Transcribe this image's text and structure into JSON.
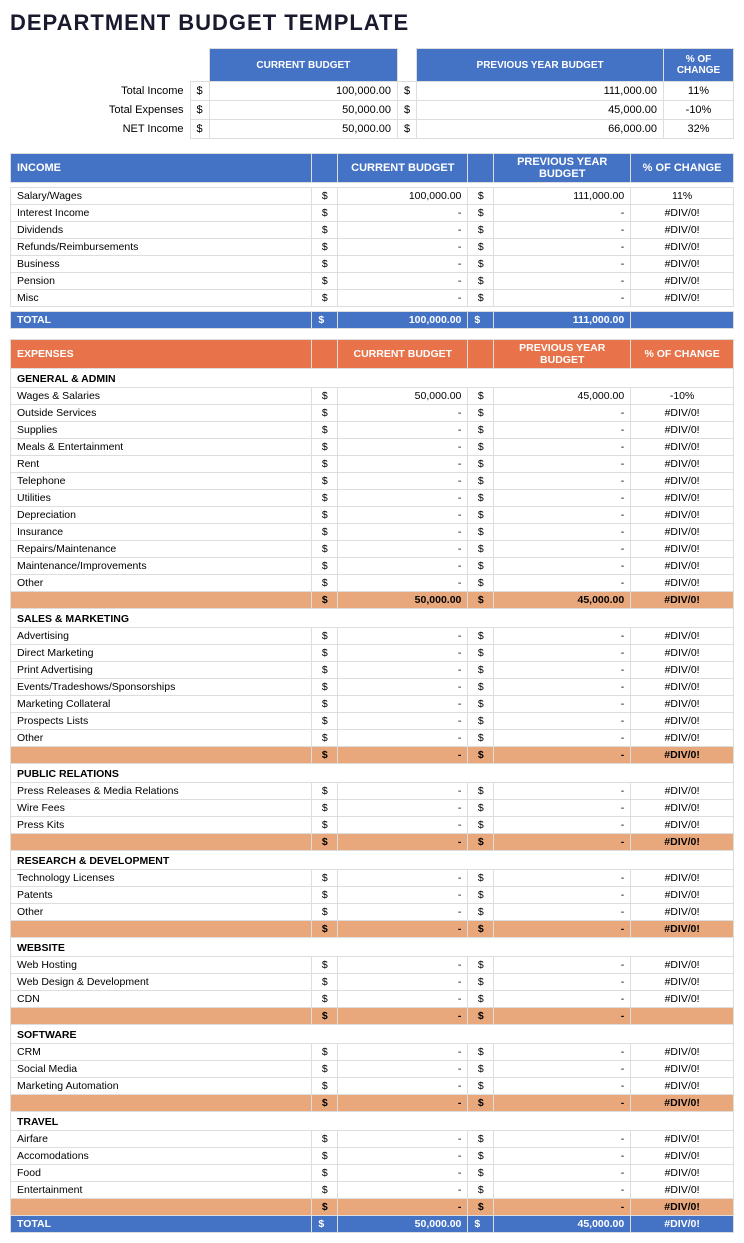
{
  "title": "DEPARTMENT BUDGET TEMPLATE",
  "summary": {
    "headers": [
      "CURRENT BUDGET",
      "PREVIOUS YEAR BUDGET",
      "% OF CHANGE"
    ],
    "rows": [
      {
        "label": "Total Income",
        "curr_dollar": "$",
        "curr_val": "100,000.00",
        "prev_dollar": "$",
        "prev_val": "111,000.00",
        "pct": "11%"
      },
      {
        "label": "Total Expenses",
        "curr_dollar": "$",
        "curr_val": "50,000.00",
        "prev_dollar": "$",
        "prev_val": "45,000.00",
        "pct": "-10%"
      },
      {
        "label": "NET Income",
        "curr_dollar": "$",
        "curr_val": "50,000.00",
        "prev_dollar": "$",
        "prev_val": "66,000.00",
        "pct": "32%"
      }
    ]
  },
  "income": {
    "section_label": "INCOME",
    "col_headers": [
      "CURRENT BUDGET",
      "PREVIOUS YEAR BUDGET",
      "% OF CHANGE"
    ],
    "rows": [
      {
        "label": "Salary/Wages",
        "curr_val": "100,000.00",
        "prev_val": "111,000.00",
        "pct": "11%"
      },
      {
        "label": "Interest Income",
        "curr_val": "-",
        "prev_val": "-",
        "pct": "#DIV/0!"
      },
      {
        "label": "Dividends",
        "curr_val": "-",
        "prev_val": "-",
        "pct": "#DIV/0!"
      },
      {
        "label": "Refunds/Reimbursements",
        "curr_val": "-",
        "prev_val": "-",
        "pct": "#DIV/0!"
      },
      {
        "label": "Business",
        "curr_val": "-",
        "prev_val": "-",
        "pct": "#DIV/0!"
      },
      {
        "label": "Pension",
        "curr_val": "-",
        "prev_val": "-",
        "pct": "#DIV/0!"
      },
      {
        "label": "Misc",
        "curr_val": "-",
        "prev_val": "-",
        "pct": "#DIV/0!"
      }
    ],
    "total_label": "TOTAL",
    "total_curr": "100,000.00",
    "total_prev": "111,000.00"
  },
  "expenses": {
    "section_label": "EXPENSES",
    "col_headers": [
      "CURRENT BUDGET",
      "PREVIOUS YEAR BUDGET",
      "% OF CHANGE"
    ],
    "subsections": [
      {
        "name": "GENERAL & ADMIN",
        "rows": [
          {
            "label": "Wages & Salaries",
            "curr_val": "50,000.00",
            "prev_val": "45,000.00",
            "pct": "-10%"
          },
          {
            "label": "Outside Services",
            "curr_val": "-",
            "prev_val": "-",
            "pct": "#DIV/0!"
          },
          {
            "label": "Supplies",
            "curr_val": "-",
            "prev_val": "-",
            "pct": "#DIV/0!"
          },
          {
            "label": "Meals & Entertainment",
            "curr_val": "-",
            "prev_val": "-",
            "pct": "#DIV/0!"
          },
          {
            "label": "Rent",
            "curr_val": "-",
            "prev_val": "-",
            "pct": "#DIV/0!"
          },
          {
            "label": "Telephone",
            "curr_val": "-",
            "prev_val": "-",
            "pct": "#DIV/0!"
          },
          {
            "label": "Utilities",
            "curr_val": "-",
            "prev_val": "-",
            "pct": "#DIV/0!"
          },
          {
            "label": "Depreciation",
            "curr_val": "-",
            "prev_val": "-",
            "pct": "#DIV/0!"
          },
          {
            "label": "Insurance",
            "curr_val": "-",
            "prev_val": "-",
            "pct": "#DIV/0!"
          },
          {
            "label": "Repairs/Maintenance",
            "curr_val": "-",
            "prev_val": "-",
            "pct": "#DIV/0!"
          },
          {
            "label": "Maintenance/Improvements",
            "curr_val": "-",
            "prev_val": "-",
            "pct": "#DIV/0!"
          },
          {
            "label": "Other",
            "curr_val": "-",
            "prev_val": "-",
            "pct": "#DIV/0!"
          }
        ],
        "subtotal_curr": "50,000.00",
        "subtotal_prev": "45,000.00",
        "subtotal_pct": "#DIV/0!"
      },
      {
        "name": "SALES & MARKETING",
        "rows": [
          {
            "label": "Advertising",
            "curr_val": "-",
            "prev_val": "-",
            "pct": "#DIV/0!"
          },
          {
            "label": "Direct Marketing",
            "curr_val": "-",
            "prev_val": "-",
            "pct": "#DIV/0!"
          },
          {
            "label": "Print Advertising",
            "curr_val": "-",
            "prev_val": "-",
            "pct": "#DIV/0!"
          },
          {
            "label": "Events/Tradeshows/Sponsorships",
            "curr_val": "-",
            "prev_val": "-",
            "pct": "#DIV/0!"
          },
          {
            "label": "Marketing Collateral",
            "curr_val": "-",
            "prev_val": "-",
            "pct": "#DIV/0!"
          },
          {
            "label": "Prospects Lists",
            "curr_val": "-",
            "prev_val": "-",
            "pct": "#DIV/0!"
          },
          {
            "label": "Other",
            "curr_val": "-",
            "prev_val": "-",
            "pct": "#DIV/0!"
          }
        ],
        "subtotal_curr": "-",
        "subtotal_prev": "-",
        "subtotal_pct": "#DIV/0!"
      },
      {
        "name": "PUBLIC RELATIONS",
        "rows": [
          {
            "label": "Press Releases & Media Relations",
            "curr_val": "-",
            "prev_val": "-",
            "pct": "#DIV/0!"
          },
          {
            "label": "Wire Fees",
            "curr_val": "-",
            "prev_val": "-",
            "pct": "#DIV/0!"
          },
          {
            "label": "Press Kits",
            "curr_val": "-",
            "prev_val": "-",
            "pct": "#DIV/0!"
          }
        ],
        "subtotal_curr": "-",
        "subtotal_prev": "-",
        "subtotal_pct": "#DIV/0!"
      },
      {
        "name": "RESEARCH & DEVELOPMENT",
        "rows": [
          {
            "label": "Technology Licenses",
            "curr_val": "-",
            "prev_val": "-",
            "pct": "#DIV/0!"
          },
          {
            "label": "Patents",
            "curr_val": "-",
            "prev_val": "-",
            "pct": "#DIV/0!"
          },
          {
            "label": "Other",
            "curr_val": "-",
            "prev_val": "-",
            "pct": "#DIV/0!"
          }
        ],
        "subtotal_curr": "-",
        "subtotal_prev": "-",
        "subtotal_pct": "#DIV/0!"
      },
      {
        "name": "WEBSITE",
        "rows": [
          {
            "label": "Web Hosting",
            "curr_val": "-",
            "prev_val": "-",
            "pct": "#DIV/0!"
          },
          {
            "label": "Web Design & Development",
            "curr_val": "-",
            "prev_val": "-",
            "pct": "#DIV/0!"
          },
          {
            "label": "CDN",
            "curr_val": "-",
            "prev_val": "-",
            "pct": "#DIV/0!"
          }
        ],
        "subtotal_curr": "-",
        "subtotal_prev": "-",
        "subtotal_pct": ""
      },
      {
        "name": "SOFTWARE",
        "rows": [
          {
            "label": "CRM",
            "curr_val": "-",
            "prev_val": "-",
            "pct": "#DIV/0!"
          },
          {
            "label": "Social Media",
            "curr_val": "-",
            "prev_val": "-",
            "pct": "#DIV/0!"
          },
          {
            "label": "Marketing Automation",
            "curr_val": "-",
            "prev_val": "-",
            "pct": "#DIV/0!"
          }
        ],
        "subtotal_curr": "-",
        "subtotal_prev": "-",
        "subtotal_pct": "#DIV/0!"
      },
      {
        "name": "TRAVEL",
        "rows": [
          {
            "label": "Airfare",
            "curr_val": "-",
            "prev_val": "-",
            "pct": "#DIV/0!"
          },
          {
            "label": "Accomodations",
            "curr_val": "-",
            "prev_val": "-",
            "pct": "#DIV/0!"
          },
          {
            "label": "Food",
            "curr_val": "-",
            "prev_val": "-",
            "pct": "#DIV/0!"
          },
          {
            "label": "Entertainment",
            "curr_val": "-",
            "prev_val": "-",
            "pct": "#DIV/0!"
          }
        ],
        "subtotal_curr": "-",
        "subtotal_prev": "-",
        "subtotal_pct": "#DIV/0!"
      }
    ],
    "total_label": "TOTAL",
    "total_curr": "50,000.00",
    "total_prev": "45,000.00",
    "total_pct": "#DIV/0!"
  }
}
